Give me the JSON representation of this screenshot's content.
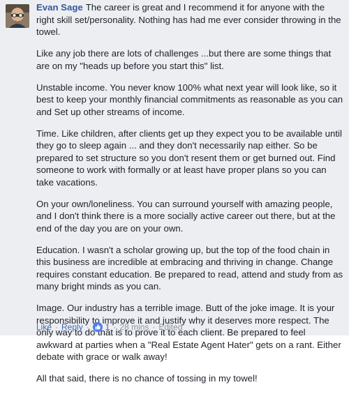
{
  "comment": {
    "author": "Evan Sage",
    "paragraphs": [
      "The career is great and I recommend it for anyone with the right skill set/personality. Nothing has had me ever consider throwing in the towel.",
      "Like any job there are lots of challenges ...but there are some things that are on my \"heads up before you start this\" list.",
      "Unstable income. You never know 100% what next year will look like, so it best to keep your monthly financial commitments as reasonable as you can and Set up other streams of income.",
      "Time. Like children, after clients get up they expect you to be available until they go to sleep again ... and they don't necessarily nap either. So be prepared to set structure so you don't resent them or get burned out. Find someone to work with formally or at least have proper plans so you can take vacations.",
      "On your own/loneliness. You can surround yourself with amazing people, and I don't think there is a more socially active career out there, but at the end of the day you are on your own.",
      "Education. I wasn't a scholar growing up, but the top of the food chain in this business are incredible at embracing and thriving in change. Change requires constant education. Be prepared to read, attend and study from as many bright minds as you can.",
      "Image. Our industry has a terrible image. Butt of the joke image. It is your responsibility to improve it and justify why it deserves more respect. The only way to do that is to prove it to each client. Be prepared to feel awkward at parties when a \"Real Estate Agent Hater\" gets on a rant. Either debate with grace or walk away!",
      "All that said, there is no chance of tossing in my towel!"
    ],
    "actions": {
      "like_label": "Like",
      "reply_label": "Reply",
      "like_count": "1",
      "timestamp": "28 mins",
      "edited_label": "Edited",
      "separator": "·"
    },
    "colors": {
      "author": "#365899",
      "link": "#4267b2",
      "meta": "#90949c",
      "background": "#eceef2",
      "like_badge": "#4c7ef3"
    },
    "icons": {
      "avatar": "avatar",
      "like_badge": "thumbs-up-icon"
    }
  }
}
